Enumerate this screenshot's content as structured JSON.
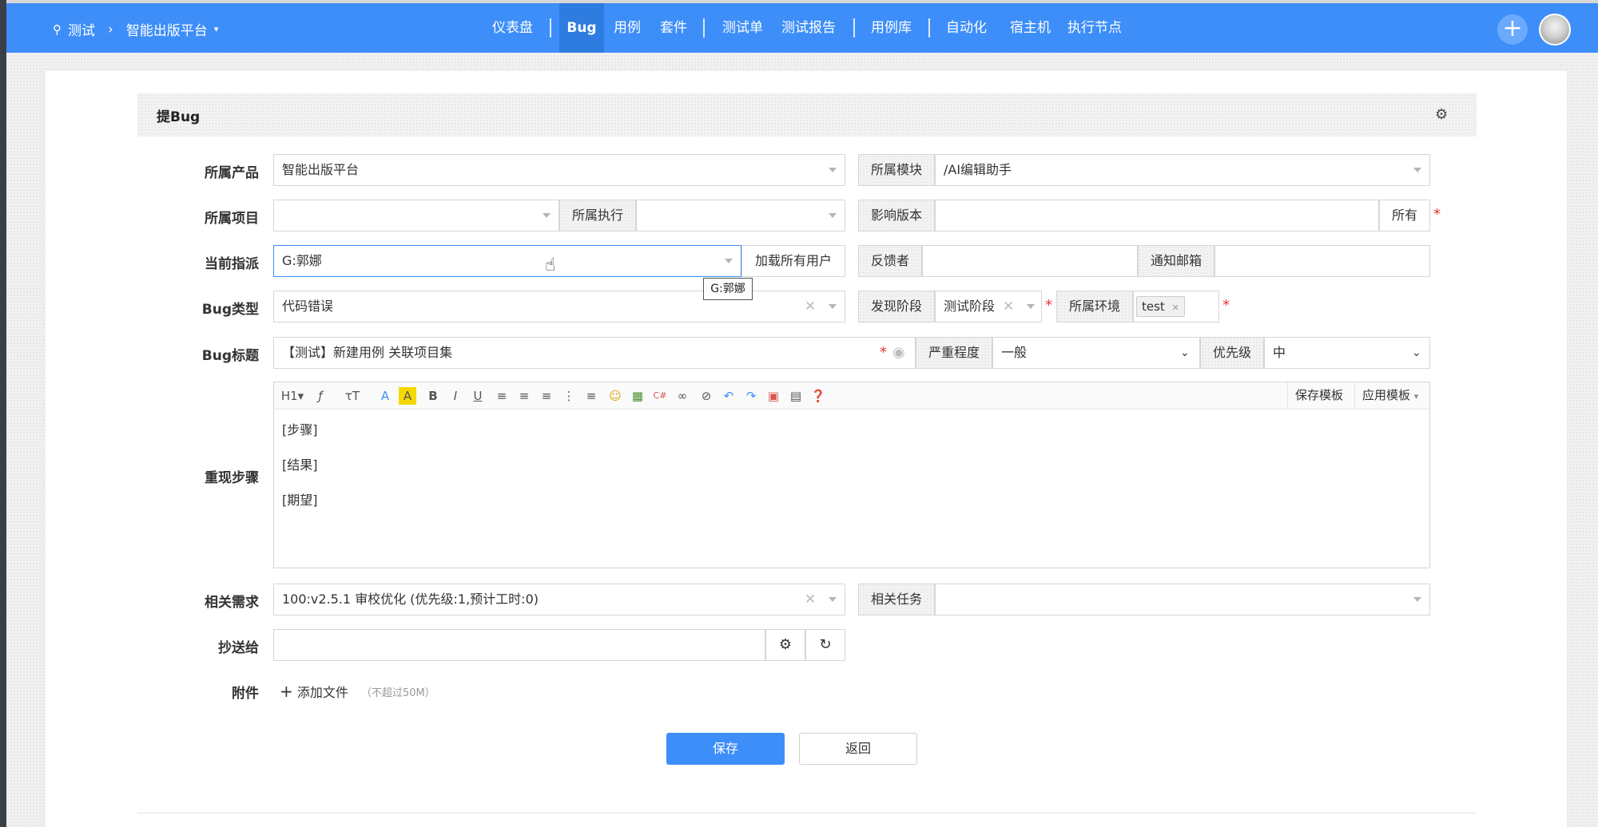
{
  "header": {
    "breadcrumb_root": "测试",
    "breadcrumb_product": "智能出版平台",
    "nav": [
      "仪表盘",
      "Bug",
      "用例",
      "套件",
      "测试单",
      "测试报告",
      "用例库",
      "自动化",
      "宿主机",
      "执行节点"
    ],
    "active_nav": "Bug"
  },
  "page": {
    "title": "提Bug"
  },
  "form": {
    "product_label": "所属产品",
    "product_value": "智能出版平台",
    "module_label": "所属模块",
    "module_value": "/AI编辑助手",
    "project_label": "所属项目",
    "project_value": "",
    "execution_label": "所属执行",
    "execution_value": "",
    "build_label": "影响版本",
    "build_value": "",
    "build_all": "所有",
    "assign_label": "当前指派",
    "assign_value": "G:郭娜",
    "load_users": "加载所有用户",
    "assign_tooltip": "G:郭娜",
    "feedback_label": "反馈者",
    "feedback_value": "",
    "notify_label": "通知邮箱",
    "notify_value": "",
    "type_label": "Bug类型",
    "type_value": "代码错误",
    "stage_label": "发现阶段",
    "stage_value": "测试阶段",
    "env_label": "所属环境",
    "env_tag": "test",
    "title_label": "Bug标题",
    "title_value": "【测试】新建用例 关联项目集",
    "severity_label": "严重程度",
    "severity_value": "一般",
    "priority_label": "优先级",
    "priority_value": "中",
    "steps_label": "重现步骤",
    "steps_lines": [
      "[步骤]",
      "[结果]",
      "[期望]"
    ],
    "save_template": "保存模板",
    "apply_template": "应用模板",
    "story_label": "相关需求",
    "story_value": "100:v2.5.1 审校优化 (优先级:1,预计工时:0)",
    "task_label": "相关任务",
    "task_value": "",
    "cc_label": "抄送给",
    "cc_value": "",
    "files_label": "附件",
    "add_file": "添加文件",
    "file_limit": "（不超过50M）"
  },
  "actions": {
    "save": "保存",
    "back": "返回"
  },
  "colors": {
    "brand": "#3d8ef8",
    "required": "#e53935"
  }
}
